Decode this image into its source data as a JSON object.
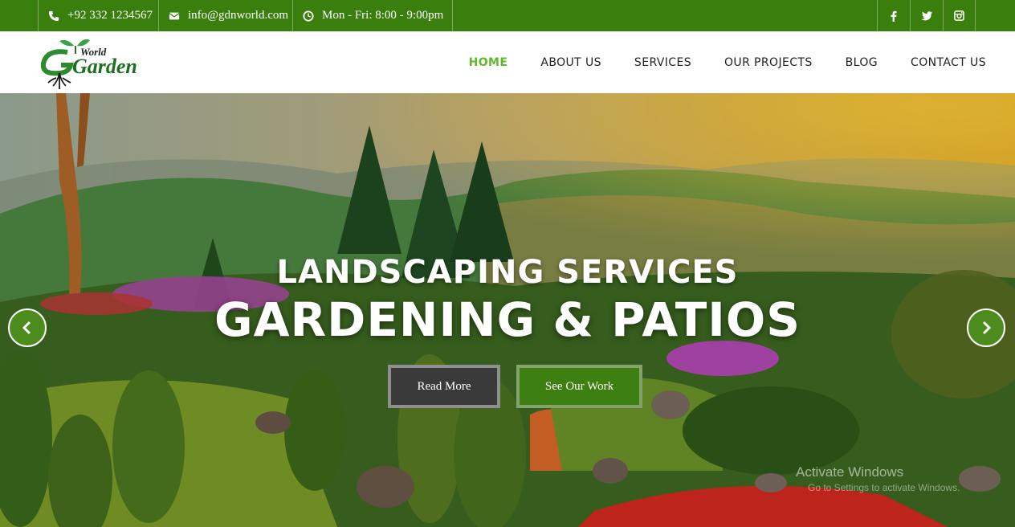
{
  "topbar": {
    "phone": "+92 332 1234567",
    "email": "info@gdnworld.com",
    "hours": "Mon - Fri: 8:00 - 9:00pm",
    "social": [
      "facebook-icon",
      "twitter-icon",
      "instagram-icon"
    ]
  },
  "logo": {
    "word1": "World",
    "word2": "Garden"
  },
  "nav": {
    "items": [
      "HOME",
      "ABOUT US",
      "SERVICES",
      "OUR PROJECTS",
      "BLOG",
      "CONTACT US"
    ],
    "active": "HOME"
  },
  "hero": {
    "title_line1": "LANDSCAPING SERVICES",
    "title_line2": "GARDENING & PATIOS",
    "button_read_more": "Read More",
    "button_see_work": "See Our Work",
    "arrows": [
      "chevron-left-icon",
      "chevron-right-icon"
    ]
  },
  "watermark": {
    "line1": "Activate Windows",
    "line2": "Go to Settings to activate Windows."
  },
  "colors": {
    "brand_green": "#3a7f0d",
    "nav_active": "#5fb82a",
    "button_dark": "#3a3a3a",
    "button_green": "#3d7f10"
  }
}
